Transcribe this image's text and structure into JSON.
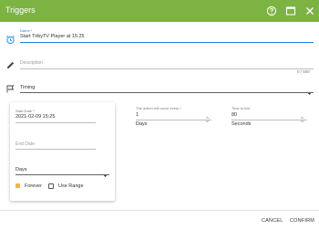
{
  "header": {
    "title": "Triggers",
    "accent": "#7cb342",
    "icons": [
      "help-circle-icon",
      "window-icon",
      "close-icon"
    ]
  },
  "name_field": {
    "label": "Name *",
    "value": "Start TribyTV Player at 15:25",
    "icon": "alarm-clock-icon"
  },
  "description_field": {
    "placeholder": "Description",
    "counter": "0 / 500",
    "icon": "pencil-icon"
  },
  "type_select": {
    "value": "Timing",
    "icon": "flag-icon"
  },
  "timing": {
    "start_date": {
      "label": "Start Date *",
      "value": "2021-02-09 15:25"
    },
    "end_date": {
      "placeholder": "End Date"
    },
    "repeat_unit": {
      "value": "Days"
    },
    "forever": {
      "label": "Forever",
      "checked": true
    },
    "use_range": {
      "label": "Use Range",
      "checked": false
    },
    "interval": {
      "label": "The action will occur every *",
      "value": "1",
      "unit": "Days"
    },
    "time_to_live": {
      "label": "Time to live",
      "value": "80",
      "unit": "Seconds"
    }
  },
  "footer": {
    "cancel": "CANCEL",
    "confirm": "CONFIRM"
  }
}
